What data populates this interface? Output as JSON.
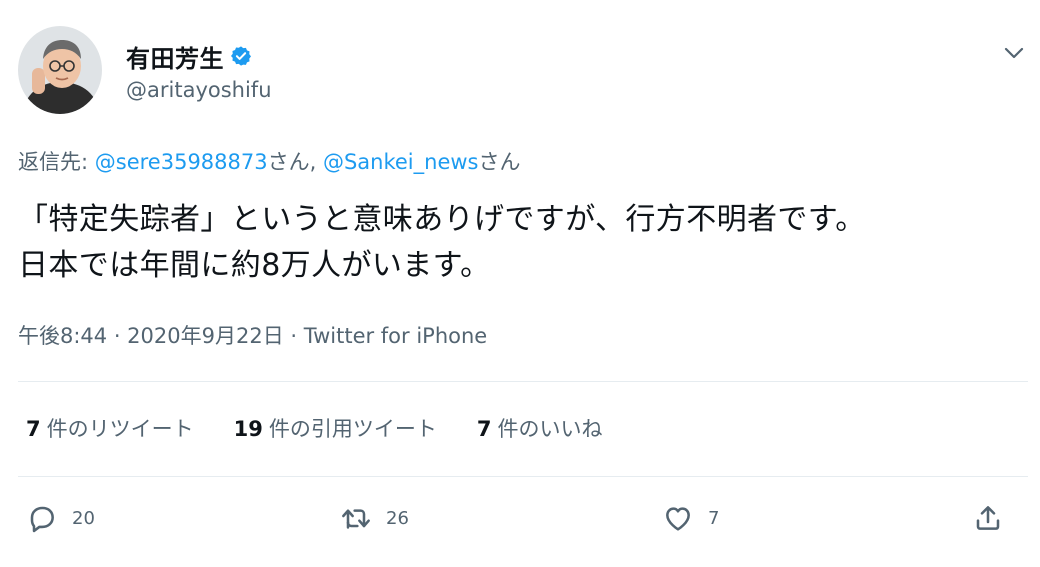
{
  "user": {
    "display_name": "有田芳生",
    "handle": "@aritayoshifu"
  },
  "reply": {
    "prefix": "返信先: ",
    "mention1": "@sere35988873",
    "suffix1": "さん, ",
    "mention2": "@Sankei_news",
    "suffix2": "さん"
  },
  "tweet": {
    "line1": "「特定失踪者」というと意味ありげですが、行方不明者です。",
    "line2": "日本では年間に約8万人がいます。"
  },
  "meta": {
    "timestamp": "午後8:44 · 2020年9月22日 · Twitter for iPhone"
  },
  "stats": {
    "retweets_num": "7",
    "retweets_label": "件のリツイート",
    "quotes_num": "19",
    "quotes_label": "件の引用ツイート",
    "likes_num": "7",
    "likes_label": "件のいいね"
  },
  "actions": {
    "reply_count": "20",
    "retweet_count": "26",
    "like_count": "7"
  },
  "colors": {
    "accent": "#1d9bf0",
    "secondary_text": "#536471"
  }
}
